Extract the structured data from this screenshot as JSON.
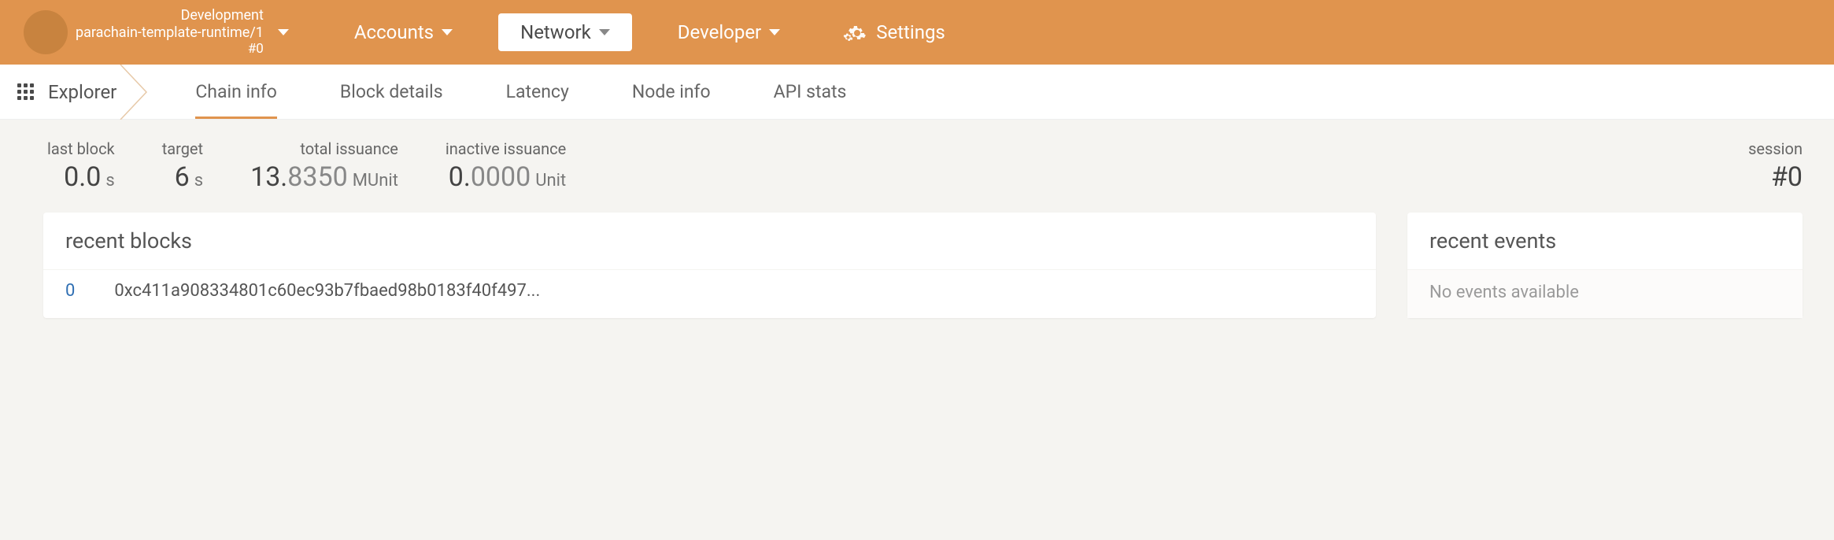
{
  "header": {
    "node": {
      "env": "Development",
      "runtime": "parachain-template-runtime/1",
      "block": "#0"
    },
    "nav": {
      "accounts": "Accounts",
      "network": "Network",
      "developer": "Developer",
      "settings": "Settings"
    }
  },
  "subtabs": {
    "explorer": "Explorer",
    "chain_info": "Chain info",
    "block_details": "Block details",
    "latency": "Latency",
    "node_info": "Node info",
    "api_stats": "API stats"
  },
  "stats": {
    "last_block": {
      "label": "last block",
      "major": "0.0",
      "unit": "s"
    },
    "target": {
      "label": "target",
      "major": "6",
      "unit": "s"
    },
    "total_issuance": {
      "label": "total issuance",
      "major": "13.",
      "minor": "8350",
      "unit": "MUnit"
    },
    "inactive_issuance": {
      "label": "inactive issuance",
      "major": "0.",
      "minor": "0000",
      "unit": "Unit"
    },
    "session": {
      "label": "session",
      "major": "#0"
    }
  },
  "panels": {
    "recent_blocks": {
      "title": "recent blocks",
      "rows": [
        {
          "num": "0",
          "hash": "0xc411a908334801c60ec93b7fbaed98b0183f40f497..."
        }
      ]
    },
    "recent_events": {
      "title": "recent events",
      "empty_text": "No events available"
    }
  }
}
